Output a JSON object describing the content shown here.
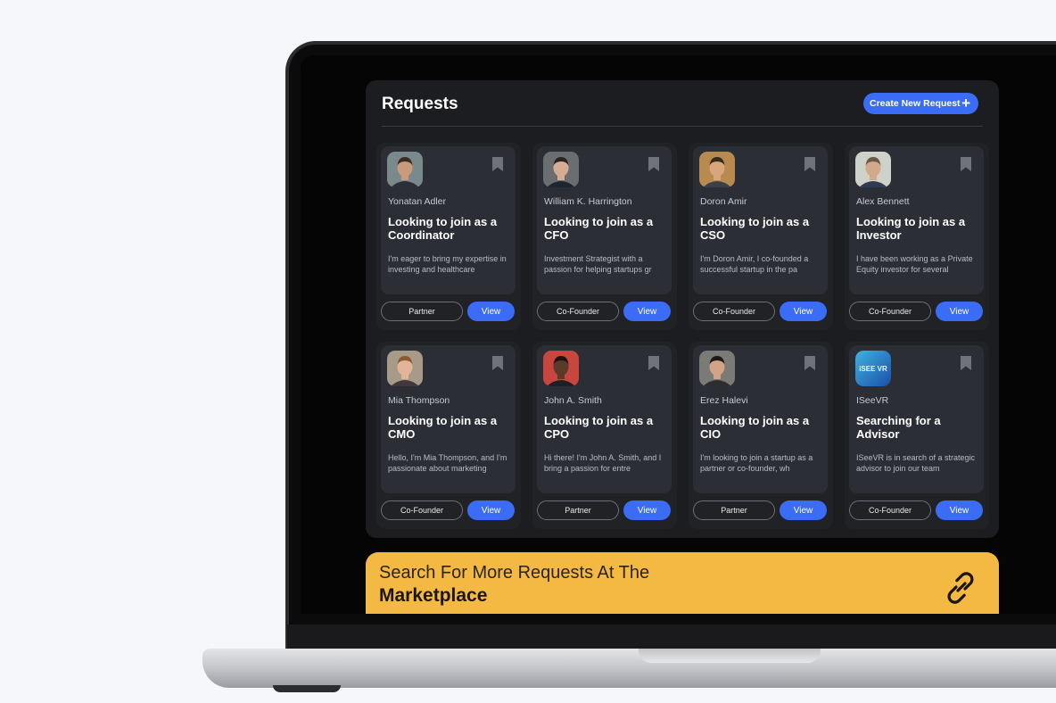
{
  "header": {
    "title": "Requests",
    "create_button_label": "Create New Request",
    "create_button_plus": "+"
  },
  "cards": [
    {
      "name": "Yonatan Adler",
      "role": "Looking to join as a Coordinator",
      "desc": "I'm eager to bring my expertise in investing and healthcare",
      "tag": "Partner",
      "view_label": "View",
      "avatar": "portrait"
    },
    {
      "name": "William K. Harrington",
      "role": "Looking to join as a CFO",
      "desc": "Investment Strategist with a passion for helping startups gr",
      "tag": "Co-Founder",
      "view_label": "View",
      "avatar": "portrait"
    },
    {
      "name": "Doron Amir",
      "role": "Looking to join as a CSO",
      "desc": "I'm Doron Amir, I co-founded a successful startup in the pa",
      "tag": "Co-Founder",
      "view_label": "View",
      "avatar": "portrait"
    },
    {
      "name": "Alex Bennett",
      "role": "Looking to join as a Investor",
      "desc": "I have been working as a Private Equity investor for several",
      "tag": "Co-Founder",
      "view_label": "View",
      "avatar": "portrait"
    },
    {
      "name": "Mia Thompson",
      "role": "Looking to join as a CMO",
      "desc": "Hello, I'm Mia Thompson, and I'm passionate about marketing",
      "tag": "Co-Founder",
      "view_label": "View",
      "avatar": "portrait"
    },
    {
      "name": "John A. Smith",
      "role": "Looking to join as a CPO",
      "desc": "Hi there! I'm John A. Smith, and I bring a passion for entre",
      "tag": "Partner",
      "view_label": "View",
      "avatar": "portrait"
    },
    {
      "name": "Erez Halevi",
      "role": "Looking to join as a CIO",
      "desc": "I'm looking to join a startup as a partner or co-founder, wh",
      "tag": "Partner",
      "view_label": "View",
      "avatar": "portrait"
    },
    {
      "name": "ISeeVR",
      "role": "Searching for a Advisor",
      "desc": "ISeeVR is in search of a strategic advisor to join our team",
      "tag": "Co-Founder",
      "view_label": "View",
      "avatar": "logo",
      "logo_text": "iSEE VR"
    }
  ],
  "banner": {
    "line1": "Search For More Requests At The",
    "line2": "Marketplace",
    "icon": "link-icon"
  },
  "colors": {
    "accent": "#3b6cf5",
    "banner": "#f4b942",
    "panel": "#1c1d21",
    "card": "#2c2e35"
  },
  "avatar_palettes": [
    {
      "bg": "#7a8a8c",
      "skin": "#c99a7c",
      "hair": "#3b2c24",
      "shirt": "#2a2f38"
    },
    {
      "bg": "#6b6e70",
      "skin": "#d6ad92",
      "hair": "#2a2320",
      "shirt": "#1e2530"
    },
    {
      "bg": "#b88a50",
      "skin": "#d9a57c",
      "hair": "#3a2a1c",
      "shirt": "#3b3f47"
    },
    {
      "bg": "#cfd2c8",
      "skin": "#d3a88b",
      "hair": "#6b5a44",
      "shirt": "#2e3b52"
    },
    {
      "bg": "#a89a88",
      "skin": "#e2b59a",
      "hair": "#8a5a34",
      "shirt": "#42373a"
    },
    {
      "bg": "#c9463f",
      "skin": "#5b3a2a",
      "hair": "#1b1412",
      "shirt": "#1d1f24"
    },
    {
      "bg": "#7a7a76",
      "skin": "#d2a487",
      "hair": "#1d1816",
      "shirt": "#2b2d30"
    },
    {
      "bg": "#1f6fbf",
      "skin": "#1f6fbf",
      "hair": "#1f6fbf",
      "shirt": "#1f6fbf"
    }
  ]
}
